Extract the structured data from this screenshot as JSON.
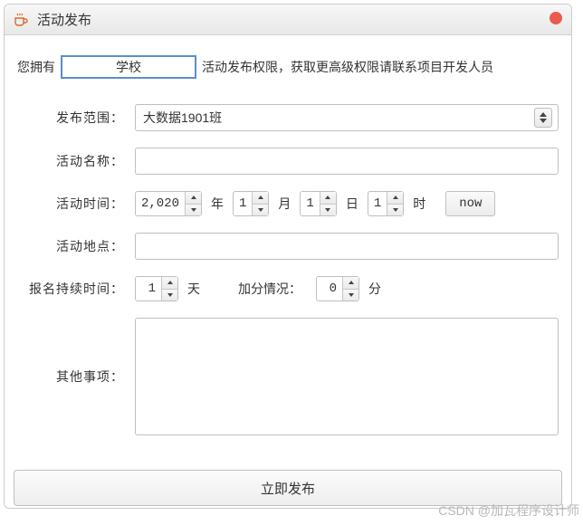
{
  "window": {
    "title": "活动发布"
  },
  "permission": {
    "prefix": "您拥有",
    "role": "学校",
    "suffix": "活动发布权限，获取更高级权限请联系项目开发人员"
  },
  "labels": {
    "scope": "发布范围：",
    "name": "活动名称：",
    "time": "活动时间：",
    "place": "活动地点：",
    "signup_duration": "报名持续时间：",
    "bonus": "加分情况：",
    "other": "其他事项："
  },
  "fields": {
    "scope_value": "大数据1901班",
    "year_value": "2,020",
    "month_value": "1",
    "day_value": "1",
    "hour_value": "1",
    "now_label": "now",
    "signup_days": "1",
    "bonus_points": "0"
  },
  "units": {
    "year": "年",
    "month": "月",
    "day": "日",
    "hour": "时",
    "days": "天",
    "points": "分"
  },
  "footer": {
    "publish": "立即发布"
  },
  "watermark": "CSDN @加瓦程序设计师"
}
